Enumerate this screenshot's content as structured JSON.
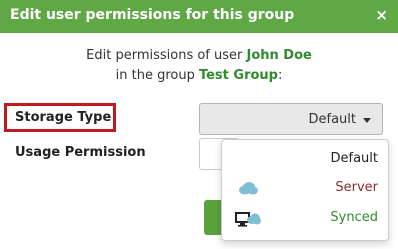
{
  "dialog": {
    "title": "Edit user permissions for this group",
    "close_icon": "×"
  },
  "intro": {
    "prefix": "Edit permissions of user ",
    "user": "John Doe",
    "middle": "in the group ",
    "group": "Test Group",
    "suffix": ":"
  },
  "form": {
    "storage_type_label": "Storage Type",
    "usage_permission_label": "Usage Permission",
    "storage_type_value": "Default"
  },
  "dropdown": {
    "options": [
      {
        "label": "Default",
        "icon": "",
        "color": "#222222"
      },
      {
        "label": "Server",
        "icon": "cloud-icon",
        "color": "#8b2d2d"
      },
      {
        "label": "Synced",
        "icon": "monitor-cloud-icon",
        "color": "#2e8b2e"
      }
    ]
  },
  "colors": {
    "header": "#60a846",
    "highlight_border": "#c0191f",
    "button": "#5aa33c"
  }
}
